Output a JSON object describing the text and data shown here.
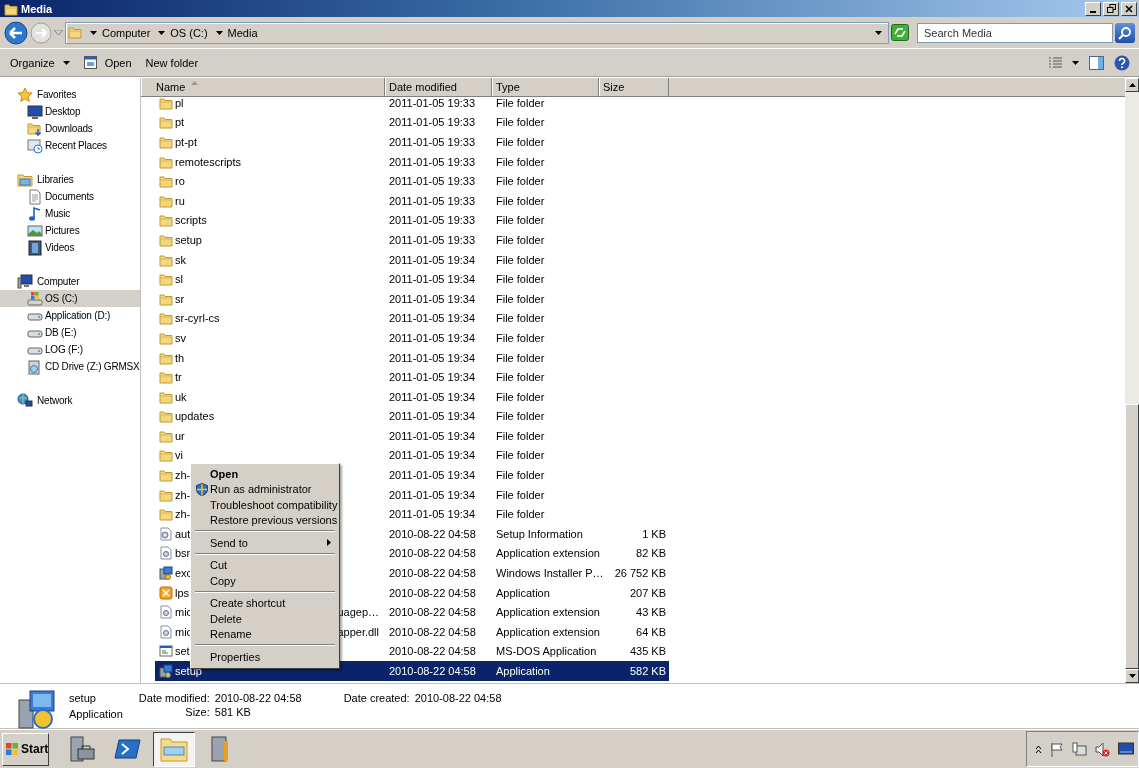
{
  "window": {
    "title": "Media"
  },
  "address_bar": {
    "breadcrumbs": [
      "Computer",
      "OS (C:)",
      "Media"
    ]
  },
  "search": {
    "placeholder": "Search Media"
  },
  "toolbar": {
    "buttons": [
      {
        "label": "Organize",
        "kind": "menu"
      },
      {
        "label": "Open",
        "kind": "open"
      },
      {
        "label": "New folder",
        "kind": "plain"
      }
    ]
  },
  "sidebar": {
    "groups": [
      {
        "label": "Favorites",
        "kind": "star",
        "selected": false,
        "children": [
          {
            "label": "Desktop",
            "kind": "desktop",
            "selected": false
          },
          {
            "label": "Downloads",
            "kind": "downloads",
            "selected": false
          },
          {
            "label": "Recent Places",
            "kind": "recent",
            "selected": false
          }
        ]
      },
      {
        "label": "Libraries",
        "kind": "library",
        "selected": false,
        "children": [
          {
            "label": "Documents",
            "kind": "document",
            "selected": false
          },
          {
            "label": "Music",
            "kind": "music",
            "selected": false
          },
          {
            "label": "Pictures",
            "kind": "picture",
            "selected": false
          },
          {
            "label": "Videos",
            "kind": "video",
            "selected": false
          }
        ]
      },
      {
        "label": "Computer",
        "kind": "computer",
        "selected": false,
        "children": [
          {
            "label": "OS (C:)",
            "kind": "system-drive",
            "selected": true
          },
          {
            "label": "Application (D:)",
            "kind": "drive",
            "selected": false
          },
          {
            "label": "DB (E:)",
            "kind": "drive",
            "selected": false
          },
          {
            "label": "LOG (F:)",
            "kind": "drive",
            "selected": false
          },
          {
            "label": "CD Drive (Z:) GRMSX",
            "kind": "cd",
            "selected": false
          }
        ]
      },
      {
        "label": "Network",
        "kind": "network",
        "selected": false
      }
    ]
  },
  "table": {
    "columns": [
      {
        "label": "Name",
        "sorted": true
      },
      {
        "label": "Date modified",
        "sorted": false
      },
      {
        "label": "Type",
        "sorted": false
      },
      {
        "label": "Size",
        "sorted": false
      }
    ],
    "rows": [
      {
        "name": "pl",
        "date": "2011-01-05 19:33",
        "type": "File folder",
        "kind": "folder",
        "selected": false
      },
      {
        "name": "pt",
        "date": "2011-01-05 19:33",
        "type": "File folder",
        "kind": "folder",
        "selected": false
      },
      {
        "name": "pt-pt",
        "date": "2011-01-05 19:33",
        "type": "File folder",
        "kind": "folder",
        "selected": false
      },
      {
        "name": "remotescripts",
        "date": "2011-01-05 19:33",
        "type": "File folder",
        "kind": "folder",
        "selected": false
      },
      {
        "name": "ro",
        "date": "2011-01-05 19:33",
        "type": "File folder",
        "kind": "folder",
        "selected": false
      },
      {
        "name": "ru",
        "date": "2011-01-05 19:33",
        "type": "File folder",
        "kind": "folder",
        "selected": false
      },
      {
        "name": "scripts",
        "date": "2011-01-05 19:33",
        "type": "File folder",
        "kind": "folder",
        "selected": false
      },
      {
        "name": "setup",
        "date": "2011-01-05 19:33",
        "type": "File folder",
        "kind": "folder",
        "selected": false
      },
      {
        "name": "sk",
        "date": "2011-01-05 19:34",
        "type": "File folder",
        "kind": "folder",
        "selected": false
      },
      {
        "name": "sl",
        "date": "2011-01-05 19:34",
        "type": "File folder",
        "kind": "folder",
        "selected": false
      },
      {
        "name": "sr",
        "date": "2011-01-05 19:34",
        "type": "File folder",
        "kind": "folder",
        "selected": false
      },
      {
        "name": "sr-cyrl-cs",
        "date": "2011-01-05 19:34",
        "type": "File folder",
        "kind": "folder",
        "selected": false
      },
      {
        "name": "sv",
        "date": "2011-01-05 19:34",
        "type": "File folder",
        "kind": "folder",
        "selected": false
      },
      {
        "name": "th",
        "date": "2011-01-05 19:34",
        "type": "File folder",
        "kind": "folder",
        "selected": false
      },
      {
        "name": "tr",
        "date": "2011-01-05 19:34",
        "type": "File folder",
        "kind": "folder",
        "selected": false
      },
      {
        "name": "uk",
        "date": "2011-01-05 19:34",
        "type": "File folder",
        "kind": "folder",
        "selected": false
      },
      {
        "name": "updates",
        "date": "2011-01-05 19:34",
        "type": "File folder",
        "kind": "folder",
        "selected": false
      },
      {
        "name": "ur",
        "date": "2011-01-05 19:34",
        "type": "File folder",
        "kind": "folder",
        "selected": false
      },
      {
        "name": "vi",
        "date": "2011-01-05 19:34",
        "type": "File folder",
        "kind": "folder",
        "selected": false
      },
      {
        "name": "zh-",
        "date": "2011-01-05 19:34",
        "type": "File folder",
        "kind": "folder",
        "selected": false
      },
      {
        "name": "zh-",
        "date": "2011-01-05 19:34",
        "type": "File folder",
        "kind": "folder",
        "selected": false
      },
      {
        "name": "zh-",
        "date": "2011-01-05 19:34",
        "type": "File folder",
        "kind": "folder",
        "selected": false
      },
      {
        "name": "aut",
        "date": "2010-08-22 04:58",
        "type": "Setup Information",
        "size": "1 KB",
        "kind": "settings",
        "selected": false
      },
      {
        "name": "bsr",
        "date": "2010-08-22 04:58",
        "type": "Application extension",
        "size": "82 KB",
        "kind": "extension",
        "selected": false
      },
      {
        "name": "exc",
        "date": "2010-08-22 04:58",
        "type": "Windows Installer P…",
        "size": "26 752 KB",
        "kind": "installer",
        "selected": false
      },
      {
        "name": "lps",
        "date": "2010-08-22 04:58",
        "type": "Application",
        "size": "207 KB",
        "kind": "app",
        "selected": false
      },
      {
        "name": "mic",
        "name_end": "uagep…",
        "date": "2010-08-22 04:58",
        "type": "Application extension",
        "size": "43 KB",
        "kind": "extension",
        "selected": false
      },
      {
        "name": "mic",
        "name_end": "apper.dll",
        "date": "2010-08-22 04:58",
        "type": "Application extension",
        "size": "64 KB",
        "kind": "extension",
        "selected": false
      },
      {
        "name": "set",
        "date": "2010-08-22 04:58",
        "type": "MS-DOS Application",
        "size": "435 KB",
        "kind": "msdos",
        "selected": false
      },
      {
        "name": "setup",
        "date": "2010-08-22 04:58",
        "type": "Application",
        "size": "582 KB",
        "kind": "setup",
        "selected": true
      }
    ]
  },
  "context_menu": {
    "items": [
      {
        "label": "Open",
        "kind": "default"
      },
      {
        "label": "Run as administrator",
        "kind": "shield"
      },
      {
        "label": "Troubleshoot compatibility",
        "kind": "plain"
      },
      {
        "label": "Restore previous versions",
        "kind": "plain"
      },
      {
        "kind": "separator"
      },
      {
        "label": "Send to",
        "kind": "submenu"
      },
      {
        "kind": "separator"
      },
      {
        "label": "Cut",
        "kind": "plain"
      },
      {
        "label": "Copy",
        "kind": "plain"
      },
      {
        "kind": "separator"
      },
      {
        "label": "Create shortcut",
        "kind": "plain"
      },
      {
        "label": "Delete",
        "kind": "plain"
      },
      {
        "label": "Rename",
        "kind": "plain"
      },
      {
        "kind": "separator"
      },
      {
        "label": "Properties",
        "kind": "plain"
      }
    ]
  },
  "details": {
    "name": "setup",
    "type": "Application",
    "fields": [
      {
        "label": "Date modified:",
        "value": "2010-08-22 04:58"
      },
      {
        "label": "Size:",
        "value": "581 KB"
      },
      {
        "label": "Date created:",
        "value": "2010-08-22 04:58"
      }
    ]
  },
  "taskbar": {
    "start": "Start",
    "apps": [
      {
        "kind": "server",
        "selected": false
      },
      {
        "kind": "shell",
        "selected": false
      },
      {
        "kind": "explorer",
        "selected": true
      },
      {
        "kind": "tools",
        "selected": false
      }
    ],
    "tray": [
      {
        "kind": "chevron"
      },
      {
        "kind": "flag"
      },
      {
        "kind": "network"
      },
      {
        "kind": "speaker-muted"
      },
      {
        "kind": "monitor"
      }
    ]
  }
}
